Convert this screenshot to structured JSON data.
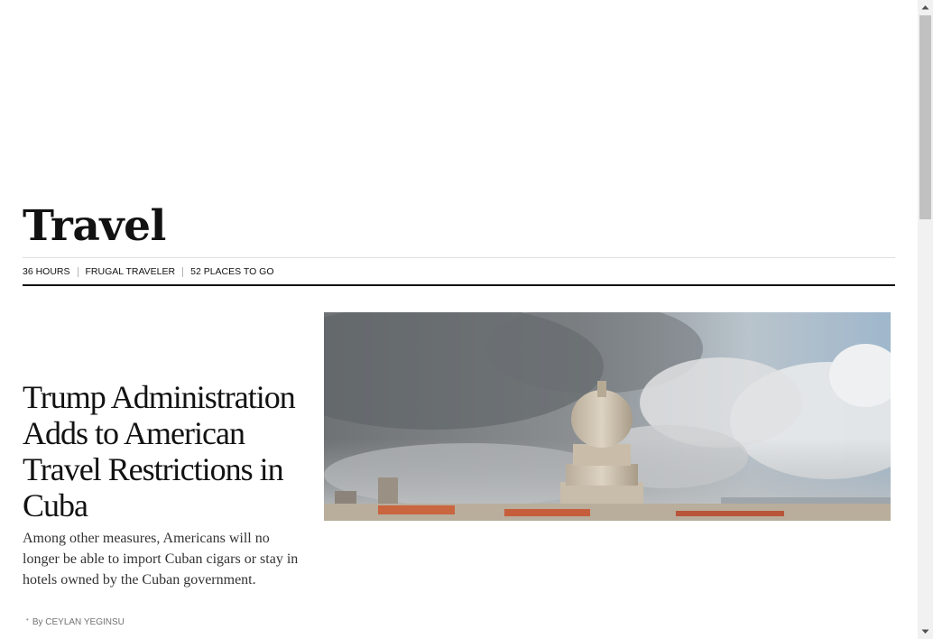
{
  "section": {
    "title": "Travel"
  },
  "subnav": {
    "items": [
      {
        "label": "36 HOURS"
      },
      {
        "label": "FRUGAL TRAVELER"
      },
      {
        "label": "52 PLACES TO GO"
      }
    ]
  },
  "story": {
    "headline": "Trump Administration Adds to American Travel Restrictions in Cuba",
    "summary": "Among other measures, Americans will no longer be able to import Cuban cigars or stay in hotels owned by the Cuban government.",
    "byline": "By CEYLAN YEGINSU"
  },
  "colors": {
    "text": "#121212",
    "rule": "#dfdfdf",
    "byline": "#727272",
    "scrollbar": "#f1f1f1",
    "scroll_thumb": "#c1c1c1"
  },
  "icons": {
    "scroll_up": "triangle-up-icon",
    "scroll_down": "triangle-down-icon",
    "byline_dot": "bullet-icon"
  }
}
